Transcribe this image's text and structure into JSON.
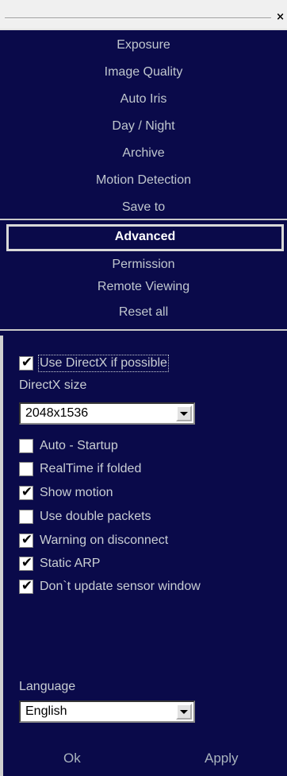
{
  "menu": {
    "items": [
      {
        "label": "Exposure"
      },
      {
        "label": "Image Quality"
      },
      {
        "label": "Auto Iris"
      },
      {
        "label": "Day / Night"
      },
      {
        "label": "Archive"
      },
      {
        "label": "Motion Detection"
      },
      {
        "label": "Save to"
      },
      {
        "label": "Advanced",
        "selected": true
      },
      {
        "label": "Permission"
      },
      {
        "label": "Remote Viewing"
      },
      {
        "label": "Reset all"
      }
    ]
  },
  "advanced": {
    "use_directx": {
      "label": "Use DirectX if possible",
      "checked": true
    },
    "directx_size_label": "DirectX size",
    "directx_size_value": "2048x1536",
    "options": [
      {
        "label": "Auto - Startup",
        "checked": false
      },
      {
        "label": "RealTime if folded",
        "checked": false
      },
      {
        "label": "Show motion",
        "checked": true
      },
      {
        "label": "Use double packets",
        "checked": false
      },
      {
        "label": "Warning on disconnect",
        "checked": true
      },
      {
        "label": "Static ARP",
        "checked": true
      },
      {
        "label": "Don`t update sensor window",
        "checked": true
      }
    ],
    "language_label": "Language",
    "language_value": "English"
  },
  "buttons": {
    "ok": "Ok",
    "apply": "Apply"
  },
  "titlebar": {
    "close_glyph": "×"
  },
  "checkmark": "✔",
  "colors": {
    "background": "#0a0a4a",
    "text": "#c9ced3"
  }
}
